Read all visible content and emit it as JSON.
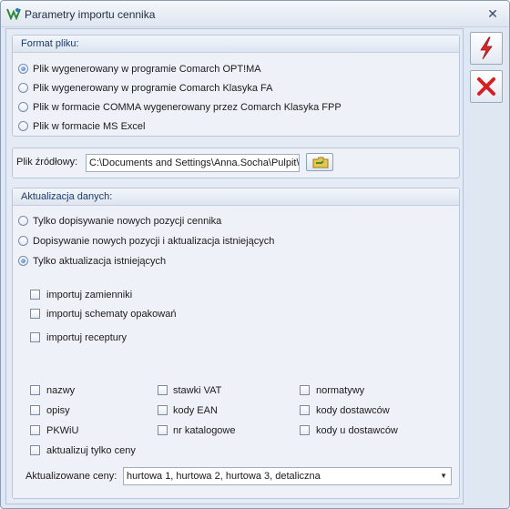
{
  "window": {
    "title": "Parametry importu cennika"
  },
  "format": {
    "title": "Format pliku:",
    "options": [
      {
        "label": "Plik wygenerowany w programie Comarch OPT!MA",
        "checked": true
      },
      {
        "label": "Plik wygenerowany w programie Comarch Klasyka FA",
        "checked": false
      },
      {
        "label": "Plik w formacie COMMA wygenerowany przez Comarch Klasyka FPP",
        "checked": false
      },
      {
        "label": "Plik w formacie MS Excel",
        "checked": false
      }
    ]
  },
  "source": {
    "label": "Plik źródłowy:",
    "path": "C:\\Documents and Settings\\Anna.Socha\\Pulpit\\c"
  },
  "update": {
    "title": "Aktualizacja danych:",
    "modes": [
      {
        "label": "Tylko dopisywanie nowych pozycji cennika",
        "checked": false
      },
      {
        "label": "Dopisywanie nowych pozycji i aktualizacja istniejących",
        "checked": false
      },
      {
        "label": "Tylko aktualizacja istniejących",
        "checked": true
      }
    ],
    "imports": [
      {
        "label": "importuj zamienniki",
        "checked": false
      },
      {
        "label": "importuj schematy opakowań",
        "checked": false
      },
      {
        "label": "importuj receptury",
        "checked": false
      }
    ],
    "fields": [
      {
        "label": "nazwy",
        "checked": false
      },
      {
        "label": "stawki VAT",
        "checked": false
      },
      {
        "label": "normatywy",
        "checked": false
      },
      {
        "label": "opisy",
        "checked": false
      },
      {
        "label": "kody EAN",
        "checked": false
      },
      {
        "label": "kody dostawców",
        "checked": false
      },
      {
        "label": "PKWiU",
        "checked": false
      },
      {
        "label": "nr katalogowe",
        "checked": false
      },
      {
        "label": "kody u dostawców",
        "checked": false
      },
      {
        "label": "aktualizuj tylko ceny",
        "checked": false
      }
    ],
    "prices": {
      "label": "Aktualizowane ceny:",
      "value": "hurtowa 1, hurtowa 2, hurtowa 3, detaliczna"
    }
  },
  "colors": {
    "confirm_icon": "#e0262a",
    "cancel_icon": "#d62020",
    "accent": "#2a72c7"
  },
  "icons": {
    "confirm": "lightning-icon",
    "cancel": "x-icon",
    "browse": "folder-icon",
    "close": "close-icon"
  }
}
